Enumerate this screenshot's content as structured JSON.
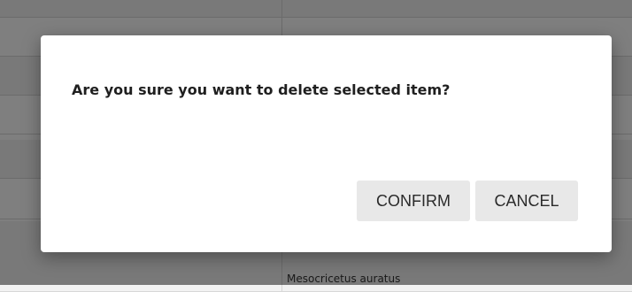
{
  "background_table": {
    "rows": [
      {
        "text": ""
      },
      {
        "text": ""
      },
      {
        "text": ""
      },
      {
        "text": ""
      },
      {
        "text": ""
      },
      {
        "text": ""
      },
      {
        "text": "Mesocricetus auratus"
      }
    ]
  },
  "dialog": {
    "message": "Are you sure you want to delete selected item?",
    "confirm_label": "CONFIRM",
    "cancel_label": "CANCEL"
  }
}
